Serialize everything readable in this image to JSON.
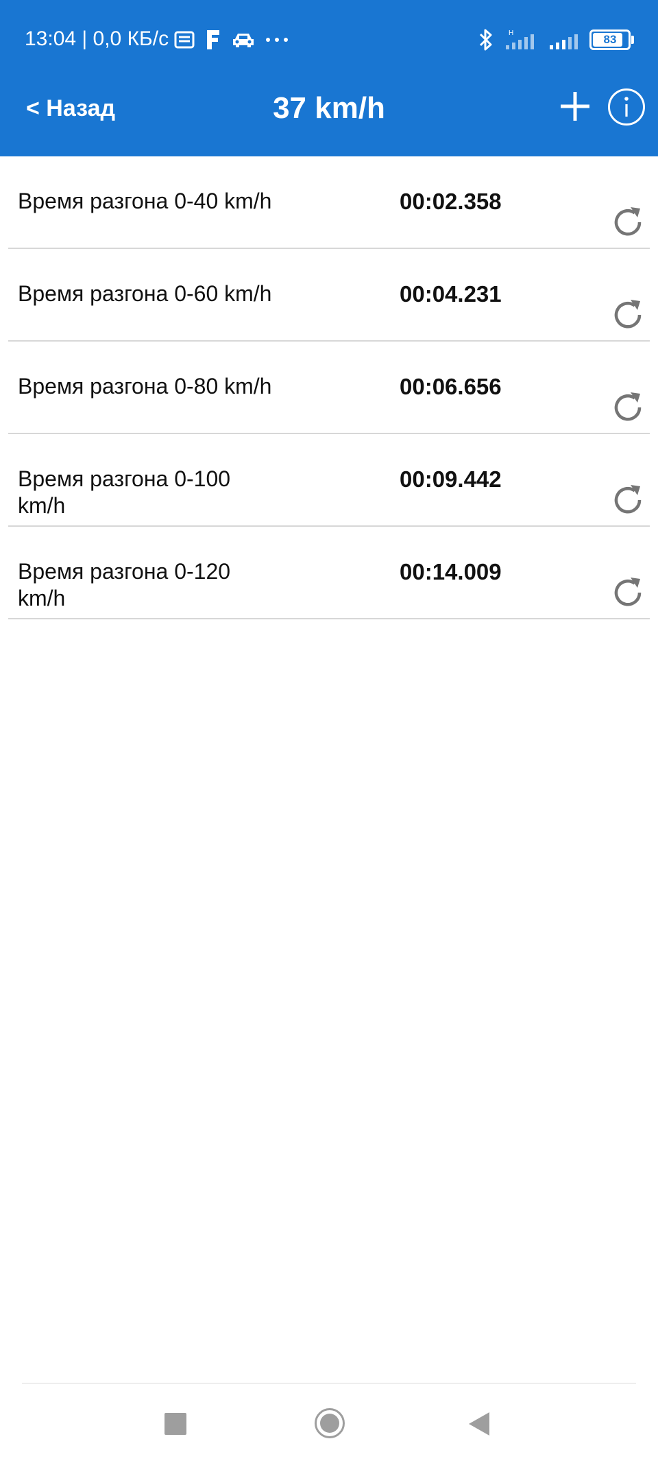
{
  "status_bar": {
    "time_text": "13:04 | 0,0 КБ/с",
    "battery_level": "83",
    "icons": [
      "notification-icon",
      "f-app-icon",
      "car-icon",
      "more-dots-icon",
      "bluetooth-icon",
      "signal-icon",
      "signal-icon",
      "battery-icon"
    ]
  },
  "header": {
    "back_label": "< Назад",
    "title": "37 km/h",
    "background_color": "#1976d2"
  },
  "acceleration_results": [
    {
      "label": "Время разгона  0-40 km/h",
      "time": "00:02.358"
    },
    {
      "label": "Время разгона  0-60 km/h",
      "time": "00:04.231"
    },
    {
      "label": "Время разгона  0-80 km/h",
      "time": "00:06.656"
    },
    {
      "label": "Время разгона  0-100 km/h",
      "time": "00:09.442"
    },
    {
      "label": "Время разгона  0-120 km/h",
      "time": "00:14.009"
    }
  ],
  "system_nav": {
    "icons": [
      "recents-square-icon",
      "home-circle-icon",
      "back-triangle-icon"
    ]
  }
}
